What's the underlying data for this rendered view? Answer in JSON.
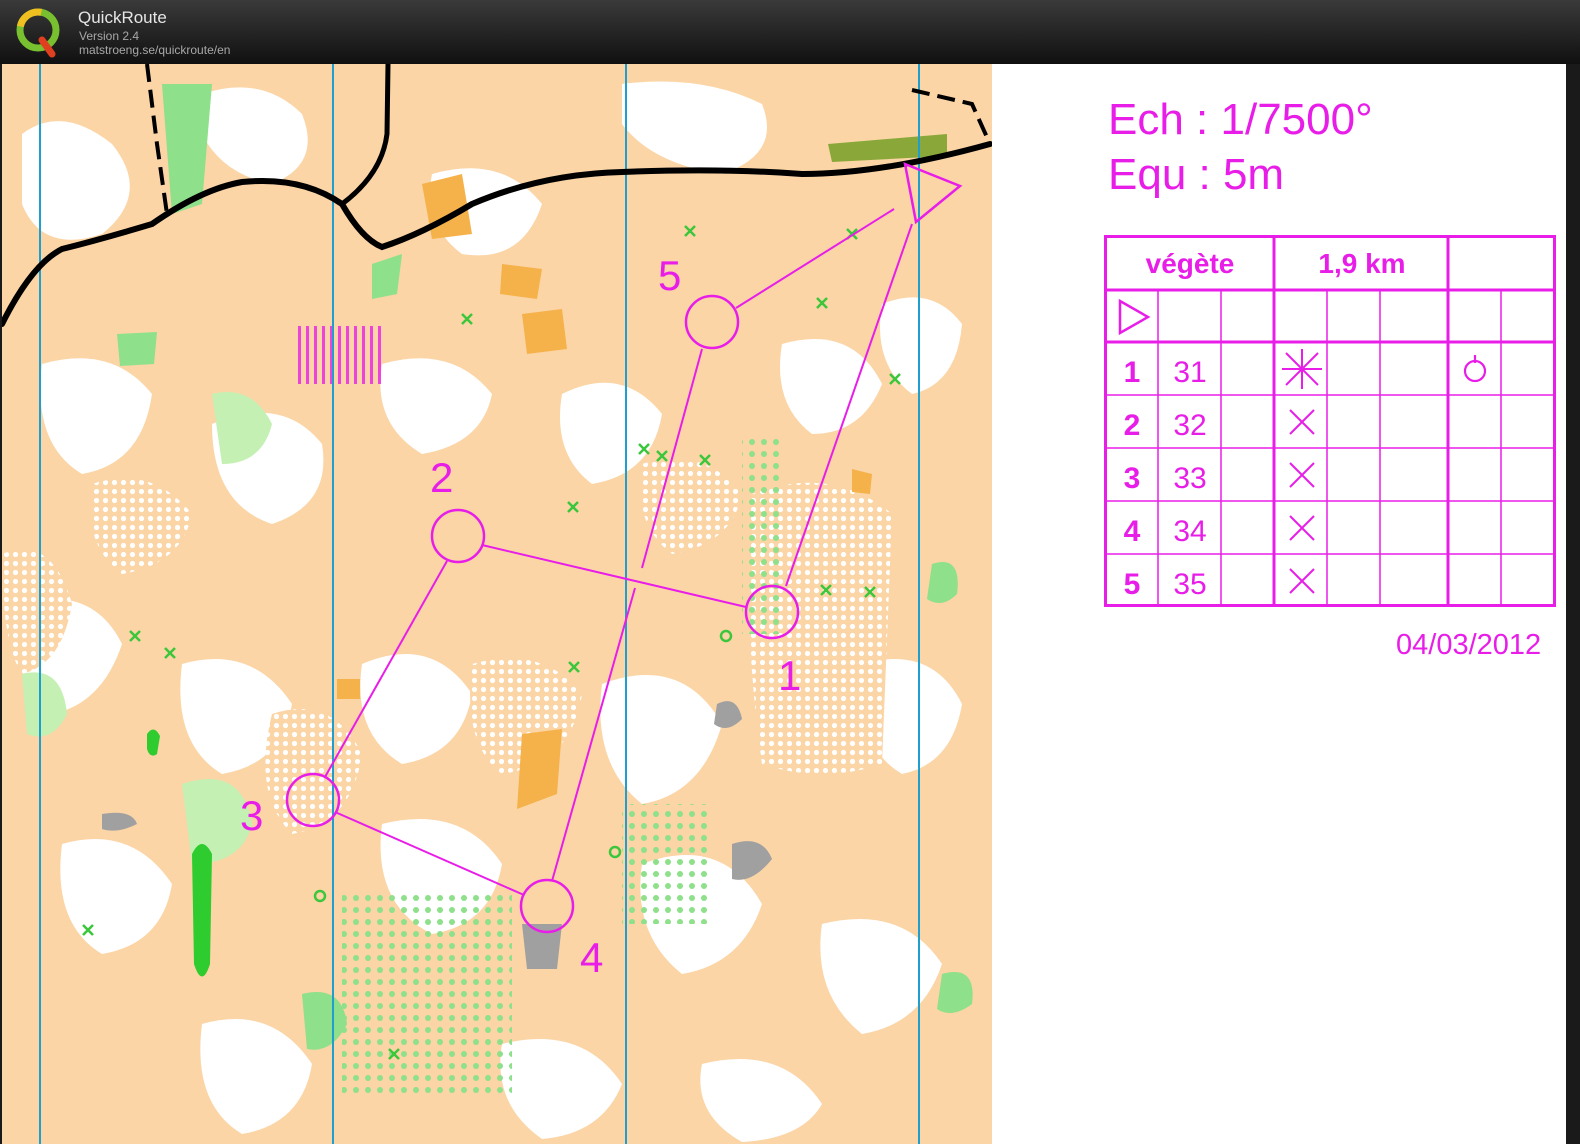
{
  "app": {
    "name": "QuickRoute",
    "version": "Version 2.4",
    "url": "matstroeng.se/quickroute/en"
  },
  "map_info": {
    "scale": "Ech : 1/7500°",
    "contour": "Equ : 5m"
  },
  "control_card": {
    "event": "végète",
    "distance": "1,9 km",
    "start_symbol": "start-triangle-icon",
    "rows": [
      {
        "num": "1",
        "code": "31",
        "feature": "thicket-cross-icon",
        "extra": "loop-icon"
      },
      {
        "num": "2",
        "code": "32",
        "feature": "cross-icon",
        "extra": ""
      },
      {
        "num": "3",
        "code": "33",
        "feature": "cross-icon",
        "extra": ""
      },
      {
        "num": "4",
        "code": "34",
        "feature": "cross-icon",
        "extra": ""
      },
      {
        "num": "5",
        "code": "35",
        "feature": "cross-icon",
        "extra": ""
      }
    ]
  },
  "date": "04/03/2012",
  "course": {
    "control_labels": [
      "1",
      "2",
      "3",
      "4",
      "5"
    ]
  },
  "colors": {
    "course": "#e81ee8",
    "open_land": "#fbd5a6",
    "vegetation": "#8ee08a",
    "track": "#000000",
    "north_lines": "#1e9fd0",
    "titlebar": "#1b1b1b"
  }
}
